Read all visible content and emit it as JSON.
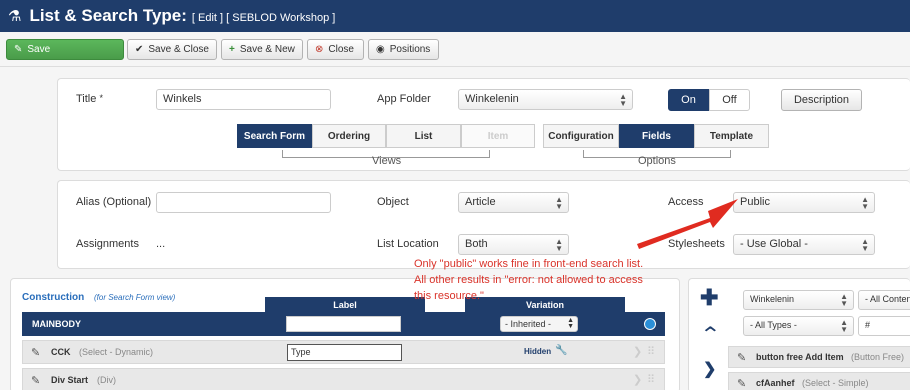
{
  "header": {
    "title": "List & Search Type:",
    "subtitle": "[ Edit ] [ SEBLOD Workshop ]"
  },
  "toolbar": {
    "save": "Save",
    "save_close": "Save & Close",
    "save_new": "Save & New",
    "close": "Close",
    "positions": "Positions"
  },
  "form": {
    "title_label": "Title",
    "title_required": "*",
    "title_value": "Winkels",
    "app_folder_label": "App Folder",
    "app_folder_value": "Winkelenin",
    "on": "On",
    "off": "Off",
    "description": "Description",
    "views_tabs": [
      "Search Form",
      "Ordering",
      "List",
      "Item"
    ],
    "views_label": "Views",
    "options_tabs": [
      "Configuration",
      "Fields",
      "Template"
    ],
    "options_label": "Options"
  },
  "meta": {
    "alias_label": "Alias (Optional)",
    "alias_value": "",
    "object_label": "Object",
    "object_value": "Article",
    "access_label": "Access",
    "access_value": "Public",
    "assignments_label": "Assignments",
    "assignments_value": "...",
    "list_location_label": "List Location",
    "list_location_value": "Both",
    "stylesheets_label": "Stylesheets",
    "stylesheets_value": "- Use Global -"
  },
  "annotation": {
    "line1": "Only \"public\" works fine in front-end search list.",
    "line2": "All other results in \"error: not allowed to access",
    "line3": "this resource.\""
  },
  "construction": {
    "title": "Construction",
    "subtitle": "(for Search Form view)",
    "col_label": "Label",
    "col_variation": "Variation",
    "mainbody": "MAINBODY",
    "variation_value": "- Inherited -",
    "rows": [
      {
        "name": "CCK",
        "type": "(Select - Dynamic)",
        "label_value": "Type",
        "variation": "Hidden"
      },
      {
        "name": "Div Start",
        "type": "(Div)"
      }
    ]
  },
  "right_panel": {
    "app_filter": "Winkelenin",
    "content_filter": "- All Conten",
    "types_filter": "- All Types -",
    "search_value": "#",
    "items": [
      {
        "name": "button free Add Item",
        "type": "(Button Free)"
      },
      {
        "name": "cfAanhef",
        "type": "(Select - Simple)"
      }
    ]
  },
  "colors": {
    "brand": "#1f3d6b",
    "success": "#5bb75b",
    "annotation": "#d9332a"
  }
}
